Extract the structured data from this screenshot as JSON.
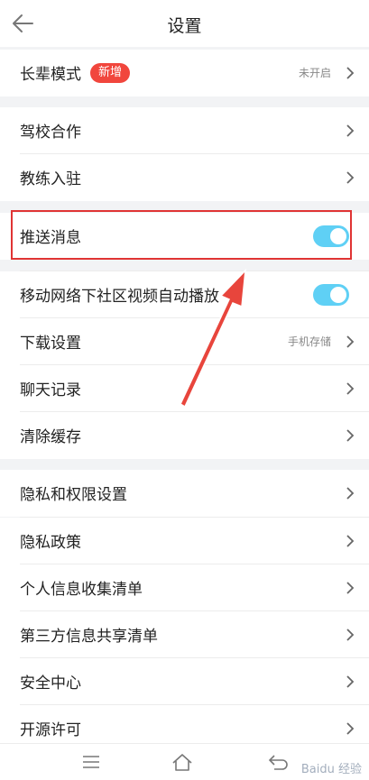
{
  "header": {
    "title": "设置",
    "back_icon": "arrow-left-icon"
  },
  "sections": {
    "elder": {
      "label": "长辈模式",
      "badge": "新增",
      "value": "未开启"
    },
    "coop": [
      {
        "label": "驾校合作"
      },
      {
        "label": "教练入驻"
      }
    ],
    "push": {
      "label": "推送消息",
      "toggle_on": true
    },
    "media": {
      "autoplay_label": "移动网络下社区视频自动播放",
      "autoplay_on": true,
      "download_label": "下载设置",
      "download_value": "手机存储",
      "chat_label": "聊天记录",
      "cache_label": "清除缓存"
    },
    "privacy": [
      {
        "label": "隐私和权限设置"
      },
      {
        "label": "隐私政策"
      },
      {
        "label": "个人信息收集清单"
      },
      {
        "label": "第三方信息共享清单"
      },
      {
        "label": "安全中心"
      },
      {
        "label": "开源许可"
      }
    ]
  },
  "nav": {
    "menu_icon": "menu-icon",
    "home_icon": "home-icon",
    "back_icon": "back-icon"
  },
  "watermark": "Baidu 经验",
  "colors": {
    "toggle": "#5fd0f5",
    "badge": "#f1463d",
    "annotation": "#e03434"
  }
}
